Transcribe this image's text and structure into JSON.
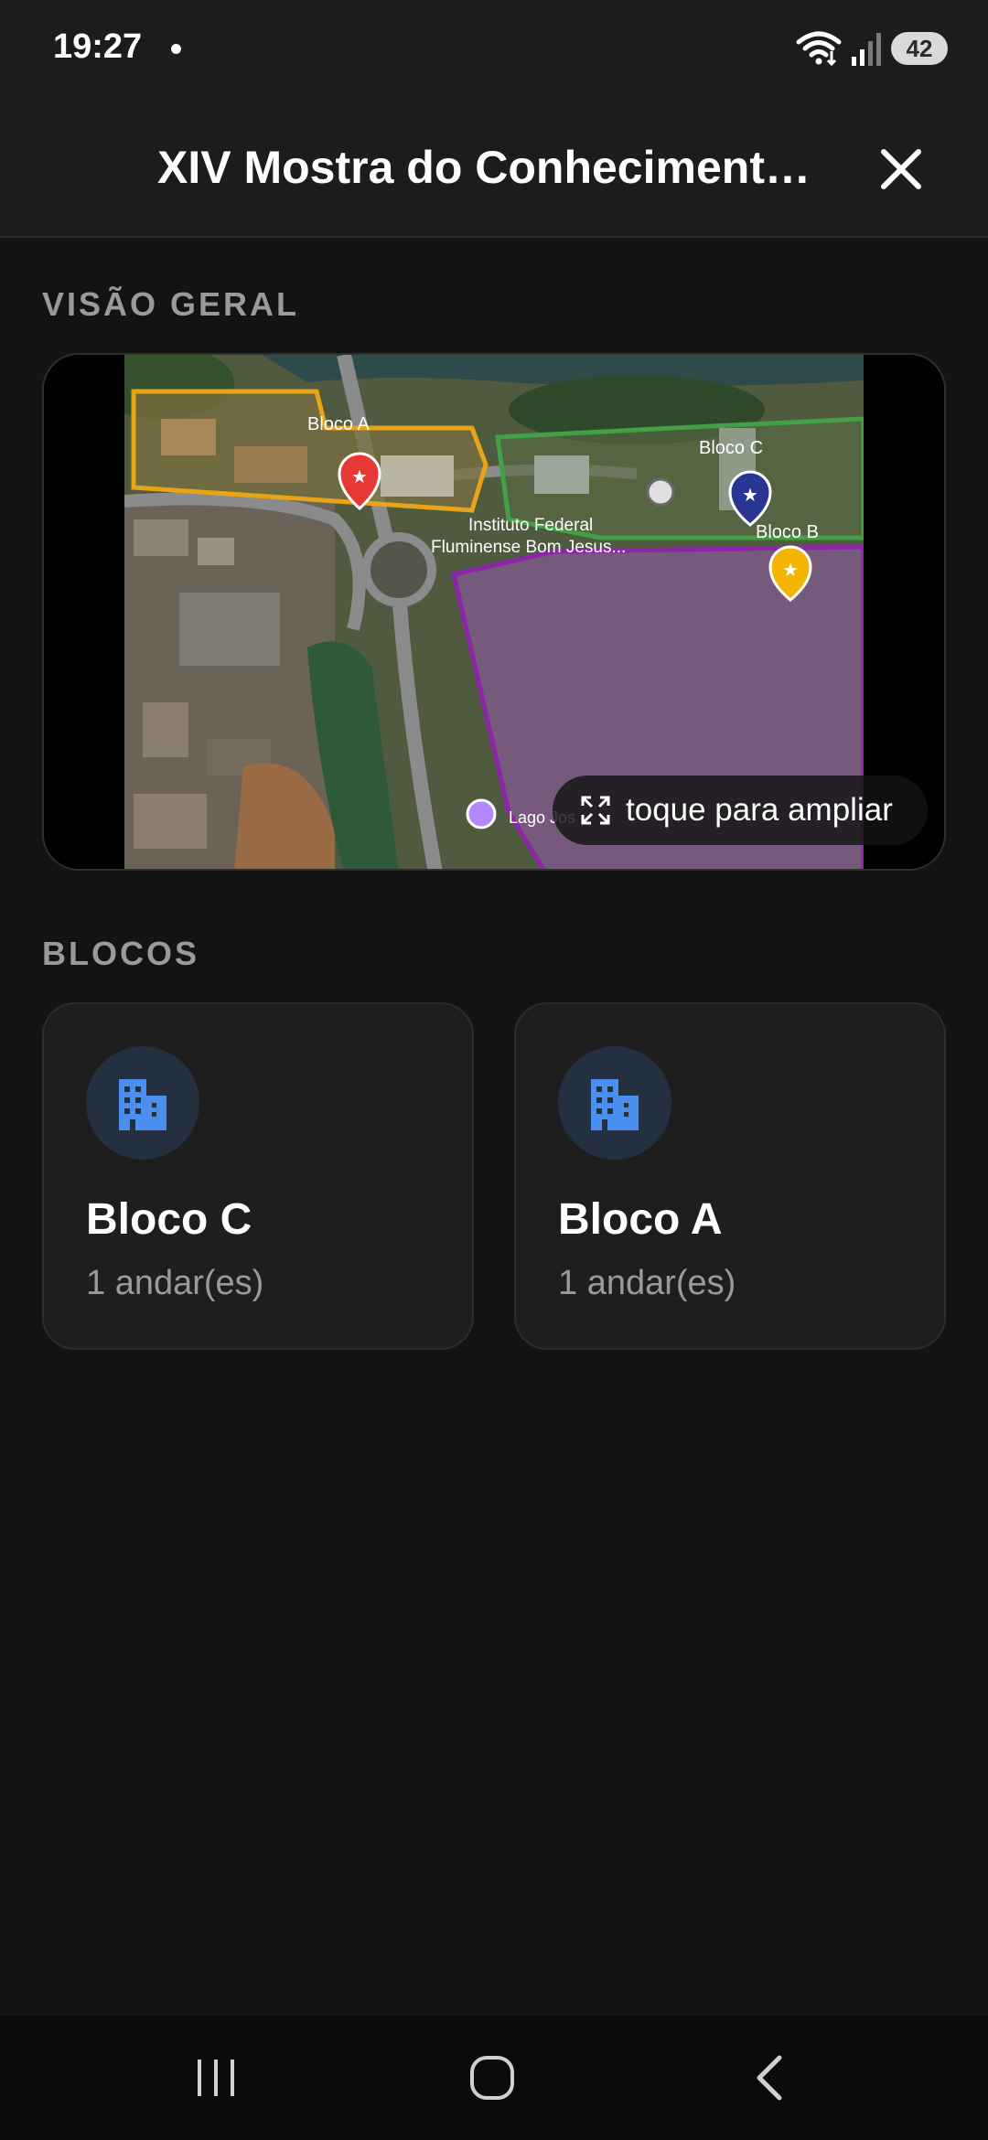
{
  "status_bar": {
    "time": "19:27",
    "battery": "42",
    "icons": [
      "notification-dot-icon",
      "wifi-icon",
      "cellular-signal-icon",
      "battery-icon"
    ]
  },
  "app_bar": {
    "title": "XIV Mostra do Conhecimento ...",
    "close_icon": "close-icon"
  },
  "overview": {
    "section_title": "VISÃO GERAL",
    "map_labels": {
      "bloco_a": "Bloco A",
      "bloco_c": "Bloco C",
      "bloco_b": "Bloco B",
      "institute_line1": "Instituto Federal",
      "institute_line2": "Fluminense Bom Jesus...",
      "lake": "Lago Jos"
    },
    "zoom_hint": "toque para ampliar",
    "zoom_icon": "expand-icon"
  },
  "blocks": {
    "section_title": "BLOCOS",
    "items": [
      {
        "name": "Bloco C",
        "floors": "1 andar(es)",
        "icon": "building-icon"
      },
      {
        "name": "Bloco A",
        "floors": "1 andar(es)",
        "icon": "building-icon"
      }
    ]
  },
  "nav_bar": {
    "buttons": [
      "recent-apps-icon",
      "home-icon",
      "back-icon"
    ]
  },
  "colors": {
    "background": "#131313",
    "card": "#1e1e1e",
    "accent_icon": "#4a8ef0",
    "muted_text": "#9a9a9a",
    "marker_red": "#e53935",
    "marker_blue": "#283593",
    "marker_yellow": "#f4b400",
    "outline_orange": "#e8a317",
    "outline_green": "#43a047",
    "outline_purple": "#7b1fa2"
  }
}
